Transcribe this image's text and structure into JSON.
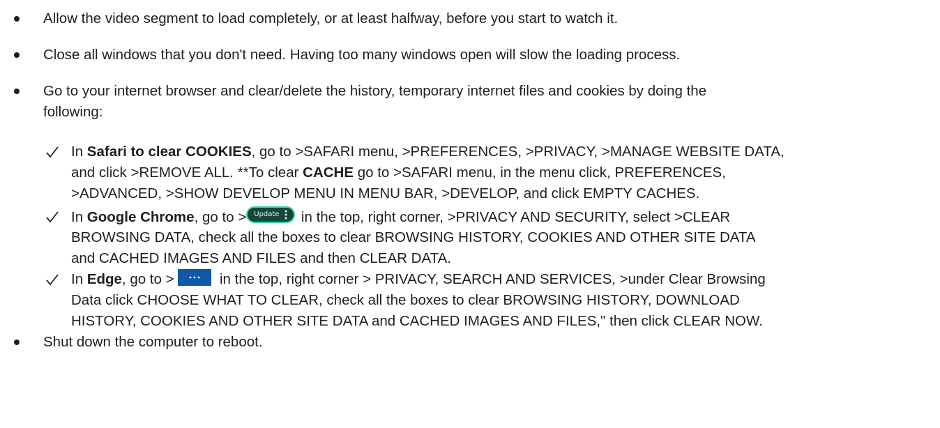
{
  "bullets": [
    {
      "lines": [
        "Allow the video segment to load completely, or at least halfway, before you start to watch it."
      ]
    },
    {
      "lines": [
        "Close all windows that you don't need. Having too many windows open will slow the loading process."
      ]
    },
    {
      "lines": [
        "Go to your internet browser and clear/delete the history, temporary internet files and cookies by doing the",
        "following:"
      ]
    },
    {
      "lines": [
        "Shut down the computer to reboot."
      ]
    }
  ],
  "safari": {
    "prefix": "In ",
    "bold1": "Safari to clear COOKIES",
    "text1": ", go to >SAFARI menu, >PREFERENCES, >PRIVACY, >MANAGE WEBSITE DATA,",
    "line2a": "and click >REMOVE ALL. **To clear ",
    "bold2": "CACHE",
    "line2b": " go to >SAFARI menu, in the menu click, PREFERENCES,",
    "line3": ">ADVANCED, >SHOW DEVELOP MENU IN MENU BAR, >DEVELOP, and click EMPTY CACHES."
  },
  "chrome": {
    "prefix": "In ",
    "bold": "Google Chrome",
    "text_before_button": ", go to >",
    "button_label": "Update",
    "button_icon": "vertical-ellipsis-icon",
    "text_after_button": " in the top, right corner, >PRIVACY AND SECURITY, select >CLEAR",
    "line2": "BROWSING DATA, check all the boxes to clear BROWSING HISTORY, COOKIES AND OTHER SITE DATA",
    "line3": "and CACHED IMAGES AND FILES and then CLEAR DATA.",
    "button_bg": "#17473a",
    "button_border": "#3fd7a2"
  },
  "edge": {
    "prefix": "In ",
    "bold": "Edge",
    "text_before_button": ", go to > ",
    "button_icon": "horizontal-ellipsis-icon",
    "text_after_button": " in the top, right corner > PRIVACY, SEARCH AND SERVICES, >under Clear Browsing",
    "line2": "Data click CHOOSE WHAT TO CLEAR, check all the boxes to clear BROWSING HISTORY, DOWNLOAD",
    "line3": "HISTORY, COOKIES AND OTHER SITE DATA and CACHED IMAGES AND FILES,\" then click CLEAR NOW.",
    "button_bg": "#0f58a8"
  }
}
